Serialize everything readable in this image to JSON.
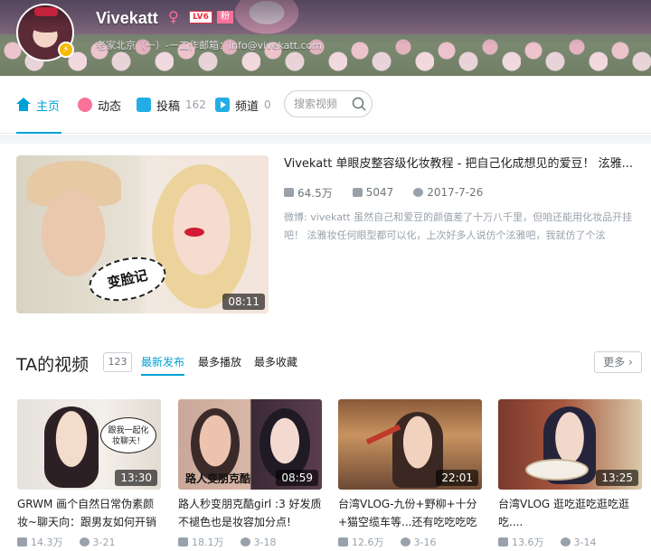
{
  "profile": {
    "username": "Vivekatt",
    "gender_icon": "female-icon",
    "level_badge": "LV6",
    "fan_tag": "粉",
    "subtitle": "老家北京（一）-一工作邮箱：info@vivekatt.com"
  },
  "nav": {
    "items": [
      {
        "label": "主页",
        "count": "",
        "icon": "home-icon"
      },
      {
        "label": "动态",
        "count": "",
        "icon": "dynamic-icon"
      },
      {
        "label": "投稿",
        "count": "162",
        "icon": "tv-icon"
      },
      {
        "label": "频道",
        "count": "0",
        "icon": "channel-icon"
      }
    ],
    "search_placeholder": "搜索视频"
  },
  "featured": {
    "title": "Vivekatt 单眼皮整容级化妆教程 - 把自己化成想见的爱豆！ 泫雅...",
    "views": "64.5万",
    "danmaku": "5047",
    "date": "2017-7-26",
    "description": "微博: vivekatt 虽然自己和爱豆的颜值差了十万八千里，但咱还能用化妆品开挂吧！ 泫雅妆任何眼型都可以化，上次好多人说仿个泫雅吧，我就仿了个泫",
    "duration": "08:11",
    "bubble_text": "变脸记"
  },
  "videos_section": {
    "title": "TA的视频",
    "count": "123",
    "tabs": [
      "最新发布",
      "最多播放",
      "最多收藏"
    ],
    "more_label": "更多",
    "cards": [
      {
        "title": "GRWM 画个自然日常伪素颜妆~聊天向：跟男友如何开销",
        "duration": "13:30",
        "views": "14.3万",
        "date": "3-21",
        "overlay": "跟我一起化妆聊天！"
      },
      {
        "title": "路人秒变朋克酷girl :3 好发质不褪色也是妆容加分点!",
        "duration": "08:59",
        "views": "18.1万",
        "date": "3-18",
        "overlay": "路人变朋克酷"
      },
      {
        "title": "台湾VLOG-九份+野柳+十分+猫空缆车等...还有吃吃吃吃",
        "duration": "22:01",
        "views": "12.6万",
        "date": "3-16",
        "overlay": ""
      },
      {
        "title": "台湾VLOG 逛吃逛吃逛吃逛吃....",
        "duration": "13:25",
        "views": "13.6万",
        "date": "3-14",
        "overlay": ""
      }
    ]
  },
  "colors": {
    "accent": "#00a1d6",
    "pink": "#fb7299",
    "muted": "#99a2aa"
  }
}
